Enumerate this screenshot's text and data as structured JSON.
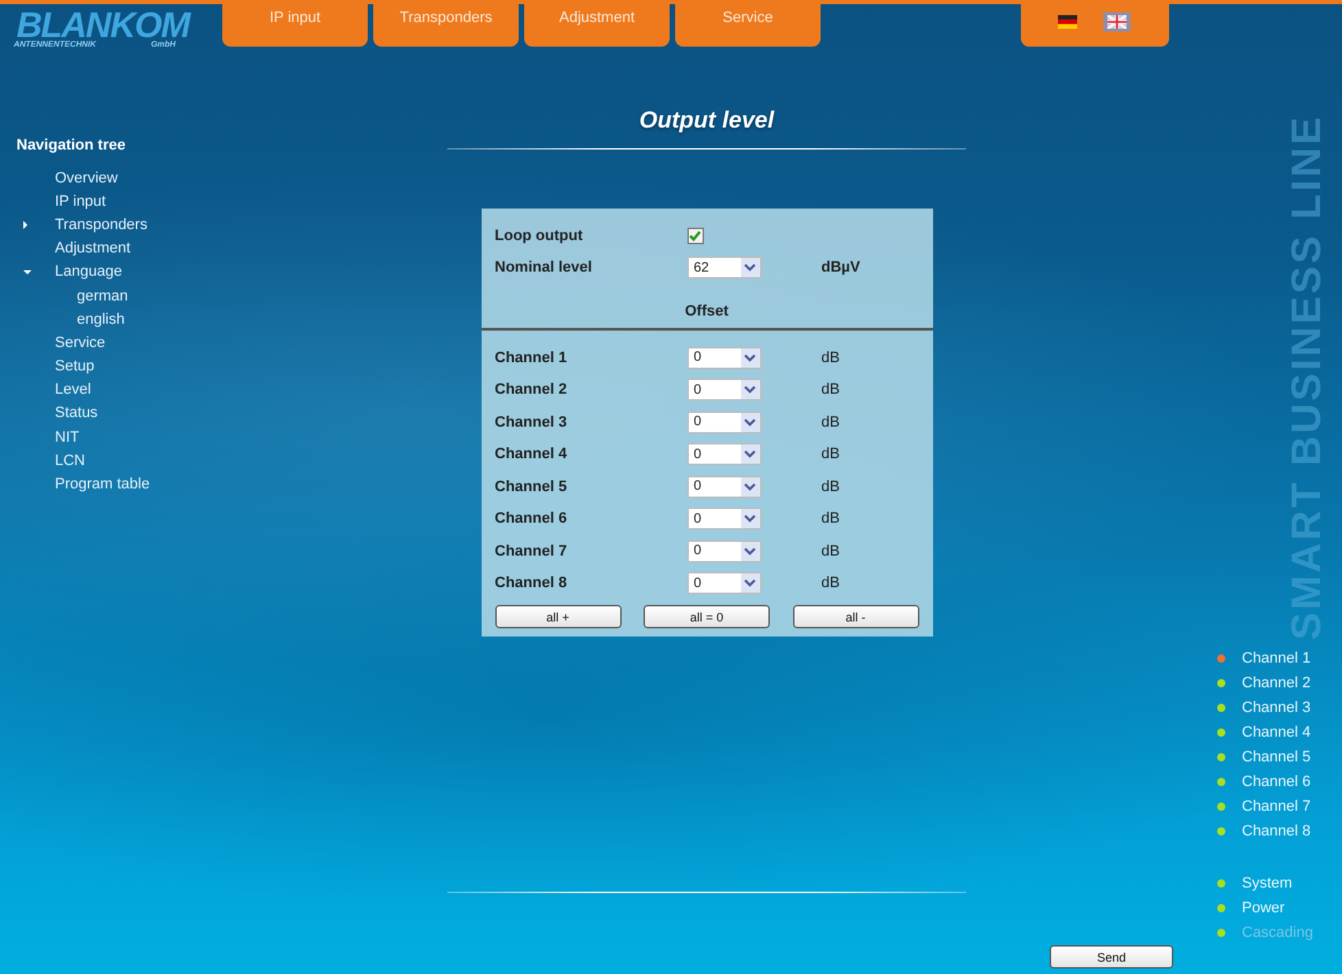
{
  "logo": {
    "brand": "BLANKOM",
    "tagline": "ANTENNENTECHNIK",
    "suffix": "GmbH"
  },
  "tabs": [
    {
      "label": "IP input"
    },
    {
      "label": "Transponders"
    },
    {
      "label": "Adjustment"
    },
    {
      "label": "Service"
    }
  ],
  "language_flags": [
    {
      "kind": "german",
      "selected": false
    },
    {
      "kind": "english",
      "selected": true
    }
  ],
  "nav": {
    "title": "Navigation tree",
    "items": [
      {
        "label": "Overview"
      },
      {
        "label": "IP input"
      },
      {
        "label": "Transponders",
        "expanded": false
      },
      {
        "label": "Adjustment"
      },
      {
        "label": "Language",
        "expanded": true,
        "children": [
          {
            "label": "german"
          },
          {
            "label": "english"
          }
        ]
      },
      {
        "label": "Service"
      },
      {
        "label": "Setup"
      },
      {
        "label": "Level"
      },
      {
        "label": "Status"
      },
      {
        "label": "NIT"
      },
      {
        "label": "LCN"
      },
      {
        "label": "Program table"
      }
    ]
  },
  "page_title": "Output level",
  "form": {
    "loop_output": {
      "label": "Loop output",
      "checked": true
    },
    "nominal_level": {
      "label": "Nominal level",
      "value": "62",
      "unit": "dBµV"
    },
    "offset_heading": "Offset",
    "channels": [
      {
        "label": "Channel 1",
        "value": "0",
        "unit": "dB"
      },
      {
        "label": "Channel 2",
        "value": "0",
        "unit": "dB"
      },
      {
        "label": "Channel 3",
        "value": "0",
        "unit": "dB"
      },
      {
        "label": "Channel 4",
        "value": "0",
        "unit": "dB"
      },
      {
        "label": "Channel 5",
        "value": "0",
        "unit": "dB"
      },
      {
        "label": "Channel 6",
        "value": "0",
        "unit": "dB"
      },
      {
        "label": "Channel 7",
        "value": "0",
        "unit": "dB"
      },
      {
        "label": "Channel 8",
        "value": "0",
        "unit": "dB"
      }
    ],
    "buttons": [
      "all +",
      "all = 0",
      "all -"
    ]
  },
  "send_button": "Send",
  "channel_status": [
    {
      "label": "Channel 1",
      "color": "#f07030"
    },
    {
      "label": "Channel 2",
      "color": "#a8e020"
    },
    {
      "label": "Channel 3",
      "color": "#a8e020"
    },
    {
      "label": "Channel 4",
      "color": "#a8e020"
    },
    {
      "label": "Channel 5",
      "color": "#a8e020"
    },
    {
      "label": "Channel 6",
      "color": "#a8e020"
    },
    {
      "label": "Channel 7",
      "color": "#a8e020"
    },
    {
      "label": "Channel 8",
      "color": "#a8e020"
    }
  ],
  "system_status": [
    {
      "label": "System",
      "color": "#a8e020",
      "disabled": false
    },
    {
      "label": "Power",
      "color": "#a8e020",
      "disabled": false
    },
    {
      "label": "Cascading",
      "color": "#a8e020",
      "disabled": true
    }
  ],
  "slogan": "SMART BUSINESS LINE"
}
